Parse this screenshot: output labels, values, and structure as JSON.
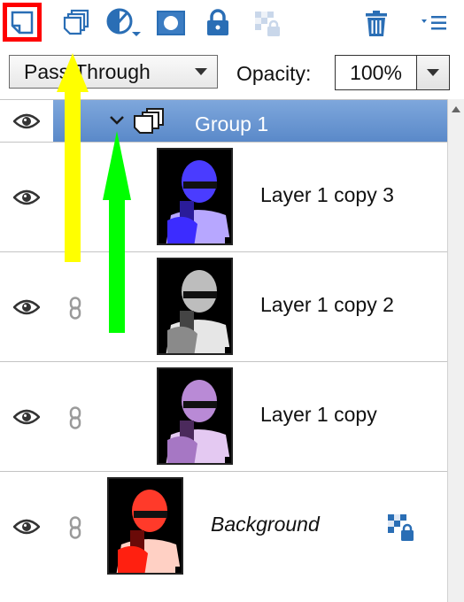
{
  "toolbar": {
    "buttons": [
      {
        "name": "new-layer-icon",
        "selected": true
      },
      {
        "name": "new-group-icon"
      },
      {
        "name": "adjustment-layer-icon"
      },
      {
        "name": "layer-mask-icon"
      },
      {
        "name": "lock-all-icon"
      },
      {
        "name": "lock-transparency-icon"
      },
      {
        "name": "trash-icon"
      },
      {
        "name": "panel-menu-icon"
      }
    ],
    "highlight_color": "#ff0000"
  },
  "blend": {
    "mode": "Pass Through",
    "opacity_label": "Opacity:",
    "opacity_value": "100%"
  },
  "layers": [
    {
      "name": "Group 1",
      "type": "group",
      "visible": true,
      "selected": true,
      "expanded": true
    },
    {
      "name": "Layer 1 copy 3",
      "type": "layer",
      "visible": true,
      "linked": false,
      "tint": "blue"
    },
    {
      "name": "Layer 1 copy 2",
      "type": "layer",
      "visible": true,
      "linked": true,
      "tint": "grayscale"
    },
    {
      "name": "Layer 1 copy",
      "type": "layer",
      "visible": true,
      "linked": true,
      "tint": "purple"
    },
    {
      "name": "Background",
      "type": "background",
      "visible": true,
      "linked": true,
      "locked": true,
      "tint": "red"
    }
  ],
  "annotations": {
    "arrow_1_color": "#ffff00",
    "arrow_2_color": "#00ff00"
  },
  "colors": {
    "selection_band": "#6a97d2",
    "accent_blue": "#2a6eb5"
  }
}
